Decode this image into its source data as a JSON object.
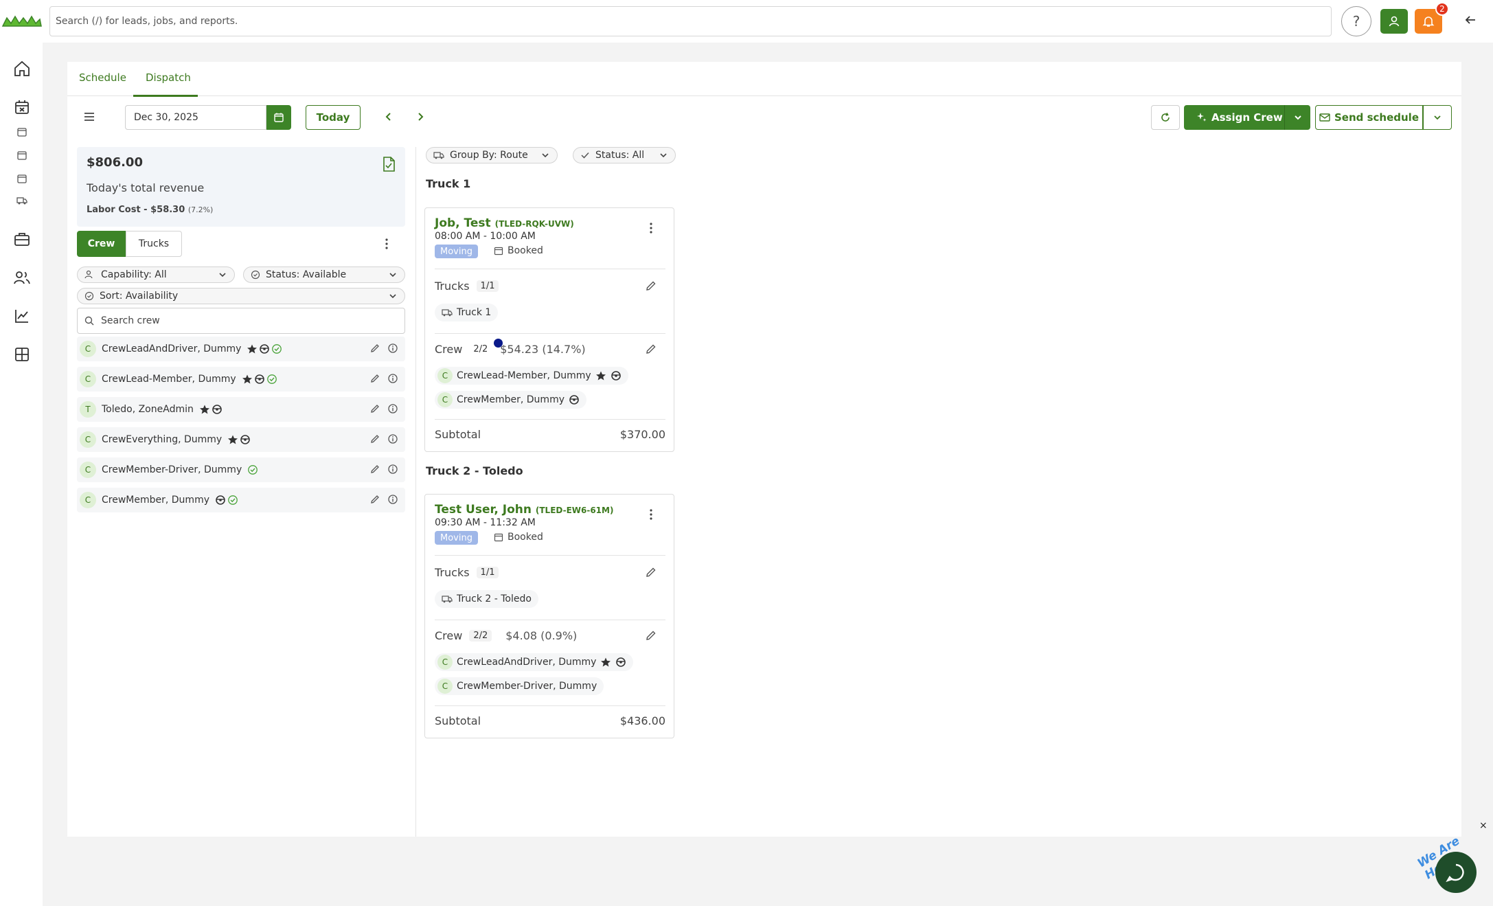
{
  "topbar": {
    "search_placeholder": "Search (/) for leads, jobs, and reports.",
    "help": "?",
    "notif_count": "2"
  },
  "tabs": [
    {
      "label": "Schedule"
    },
    {
      "label": "Dispatch"
    }
  ],
  "toolbar": {
    "date": "Dec 30, 2025",
    "today": "Today",
    "assign_crew": "Assign Crew",
    "send_schedule": "Send schedule"
  },
  "revenue": {
    "amount": "$806.00",
    "label": "Today's total revenue",
    "labor": "Labor Cost - $58.30",
    "labor_pct": "(7.2%)"
  },
  "segments": {
    "crew": "Crew",
    "trucks": "Trucks"
  },
  "filters": {
    "capability": "Capability: All",
    "status": "Status: Available",
    "sort": "Sort: Availability",
    "search_placeholder": "Search crew"
  },
  "crew_list": [
    {
      "initial": "C",
      "name": "CrewLeadAndDriver, Dummy"
    },
    {
      "initial": "C",
      "name": "CrewLead-Member, Dummy"
    },
    {
      "initial": "T",
      "name": "Toledo, ZoneAdmin"
    },
    {
      "initial": "C",
      "name": "CrewEverything, Dummy"
    },
    {
      "initial": "C",
      "name": "CrewMember-Driver, Dummy"
    },
    {
      "initial": "C",
      "name": "CrewMember, Dummy"
    }
  ],
  "board": {
    "group_by": "Group By: Route",
    "status": "Status: All"
  },
  "routes": [
    {
      "heading": "Truck 1",
      "job": {
        "name": "Job, Test",
        "code": "(TLED-RQK-UVW)",
        "time": "08:00 AM - 10:00 AM",
        "type": "Moving",
        "status": "Booked",
        "trucks_label": "Trucks",
        "trucks_count": "1/1",
        "truck": "Truck 1",
        "crew_label": "Crew",
        "crew_count": "2/2",
        "crew_cost": "$54.23 (14.7%)",
        "members": [
          {
            "initial": "C",
            "name": "CrewLead-Member, Dummy"
          },
          {
            "initial": "C",
            "name": "CrewMember, Dummy"
          }
        ],
        "subtotal_label": "Subtotal",
        "subtotal": "$370.00"
      }
    },
    {
      "heading": "Truck 2 - Toledo",
      "job": {
        "name": "Test User, John",
        "code": "(TLED-EW6-61M)",
        "time": "09:30 AM - 11:32 AM",
        "type": "Moving",
        "status": "Booked",
        "trucks_label": "Trucks",
        "trucks_count": "1/1",
        "truck": "Truck 2 - Toledo",
        "crew_label": "Crew",
        "crew_count": "2/2",
        "crew_cost": "$4.08 (0.9%)",
        "members": [
          {
            "initial": "C",
            "name": "CrewLeadAndDriver, Dummy"
          },
          {
            "initial": "C",
            "name": "CrewMember-Driver, Dummy"
          }
        ],
        "subtotal_label": "Subtotal",
        "subtotal": "$436.00"
      }
    }
  ],
  "chat": {
    "label": "We Are Here!",
    "close": "×"
  },
  "colors": {
    "brand_green": "#3d8428",
    "text_green": "#3d7a1f",
    "notif_orange": "#f5811f",
    "moving_badge": "#9fb7e8"
  }
}
